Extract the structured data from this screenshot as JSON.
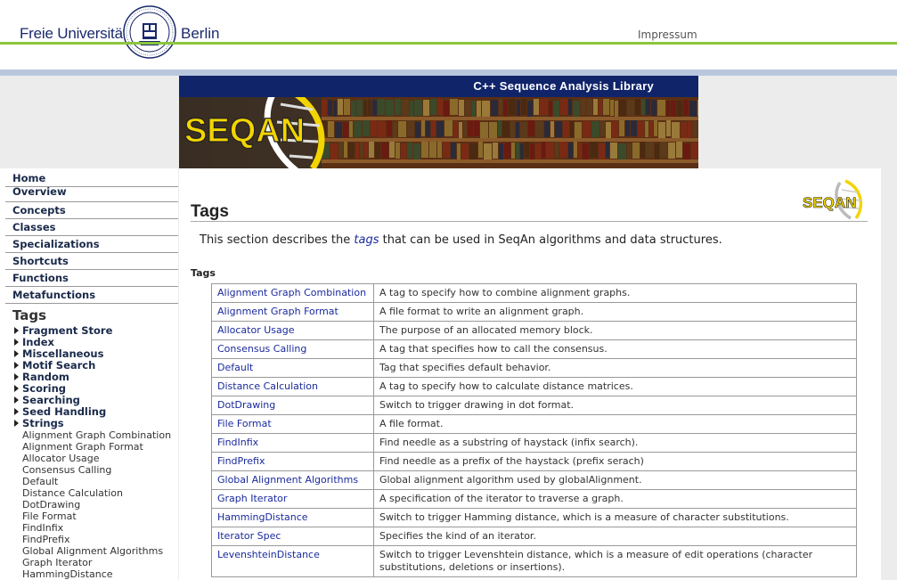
{
  "header": {
    "university_left": "Freie Universität",
    "university_right": "Berlin",
    "impressum": "Impressum"
  },
  "banner": {
    "title": "C++ Sequence Analysis Library",
    "logo_text": "SEQAN"
  },
  "sidebar": {
    "main_nav": [
      "Home",
      "Overview",
      "Concepts",
      "Classes",
      "Specializations",
      "Shortcuts",
      "Functions",
      "Metafunctions"
    ],
    "section_title": "Tags",
    "categories": [
      "Fragment Store",
      "Index",
      "Miscellaneous",
      "Motif Search",
      "Random",
      "Scoring",
      "Searching",
      "Seed Handling",
      "Strings"
    ],
    "items": [
      "Alignment Graph Combination",
      "Alignment Graph Format",
      "Allocator Usage",
      "Consensus Calling",
      "Default",
      "Distance Calculation",
      "DotDrawing",
      "File Format",
      "FindInfix",
      "FindPrefix",
      "Global Alignment Algorithms",
      "Graph Iterator",
      "HammingDistance"
    ]
  },
  "main": {
    "title": "Tags",
    "intro_before": "This section describes the ",
    "intro_link": "tags",
    "intro_after": " that can be used in SeqAn algorithms and data structures.",
    "table_heading": "Tags",
    "rows": [
      {
        "name": "Alignment Graph Combination",
        "desc": "A tag to specify how to combine alignment graphs."
      },
      {
        "name": "Alignment Graph Format",
        "desc": "A file format to write an alignment graph."
      },
      {
        "name": "Allocator Usage",
        "desc": "The purpose of an allocated memory block."
      },
      {
        "name": "Consensus Calling",
        "desc": "A tag that specifies how to call the consensus."
      },
      {
        "name": "Default",
        "desc": "Tag that specifies default behavior."
      },
      {
        "name": "Distance Calculation",
        "desc": "A tag to specify how to calculate distance matrices."
      },
      {
        "name": "DotDrawing",
        "desc": "Switch to trigger drawing in dot format."
      },
      {
        "name": "File Format",
        "desc": "A file format."
      },
      {
        "name": "FindInfix",
        "desc": "Find needle as a substring of haystack (infix search)."
      },
      {
        "name": "FindPrefix",
        "desc": "Find needle as a prefix of the haystack (prefix serach)"
      },
      {
        "name": "Global Alignment Algorithms",
        "desc": "Global alignment algorithm used by globalAlignment."
      },
      {
        "name": "Graph Iterator",
        "desc": "A specification of the iterator to traverse a graph."
      },
      {
        "name": "HammingDistance",
        "desc": "Switch to trigger Hamming distance, which is a measure of character substitutions."
      },
      {
        "name": "Iterator Spec",
        "desc": "Specifies the kind of an iterator."
      },
      {
        "name": "LevenshteinDistance",
        "desc": "Switch to trigger Levenshtein distance, which is a measure of edit operations (character substitutions, deletions or insertions)."
      }
    ]
  },
  "colors": {
    "fu_blue": "#1a2a6c",
    "fu_green": "#8cc63f",
    "banner_navy": "#10246a",
    "link_blue": "#1a2a9c",
    "seqan_yellow": "#f2d500"
  }
}
